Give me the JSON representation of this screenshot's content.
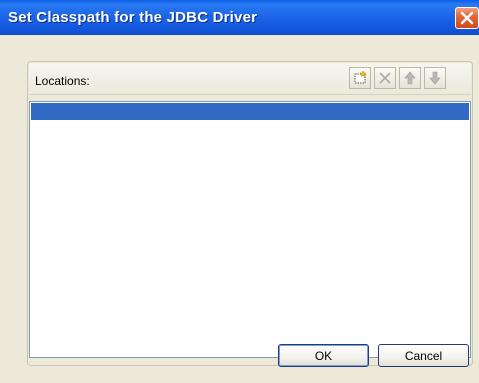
{
  "window": {
    "title": "Set Classpath for the JDBC Driver",
    "close_icon": "close-icon"
  },
  "locations": {
    "label": "Locations:",
    "toolbar": [
      {
        "name": "add-location-button",
        "icon": "new-folder-icon"
      },
      {
        "name": "remove-location-button",
        "icon": "delete-x-icon"
      },
      {
        "name": "move-up-button",
        "icon": "arrow-up-icon"
      },
      {
        "name": "move-down-button",
        "icon": "arrow-down-icon"
      }
    ],
    "items": [
      ""
    ],
    "selected_index": 0
  },
  "buttons": {
    "ok_label": "OK",
    "cancel_label": "Cancel"
  },
  "colors": {
    "titlebar": "#1d66e8",
    "selection": "#316ac5",
    "dialog_bg": "#ece9d8",
    "close_button": "#d24b1c"
  }
}
